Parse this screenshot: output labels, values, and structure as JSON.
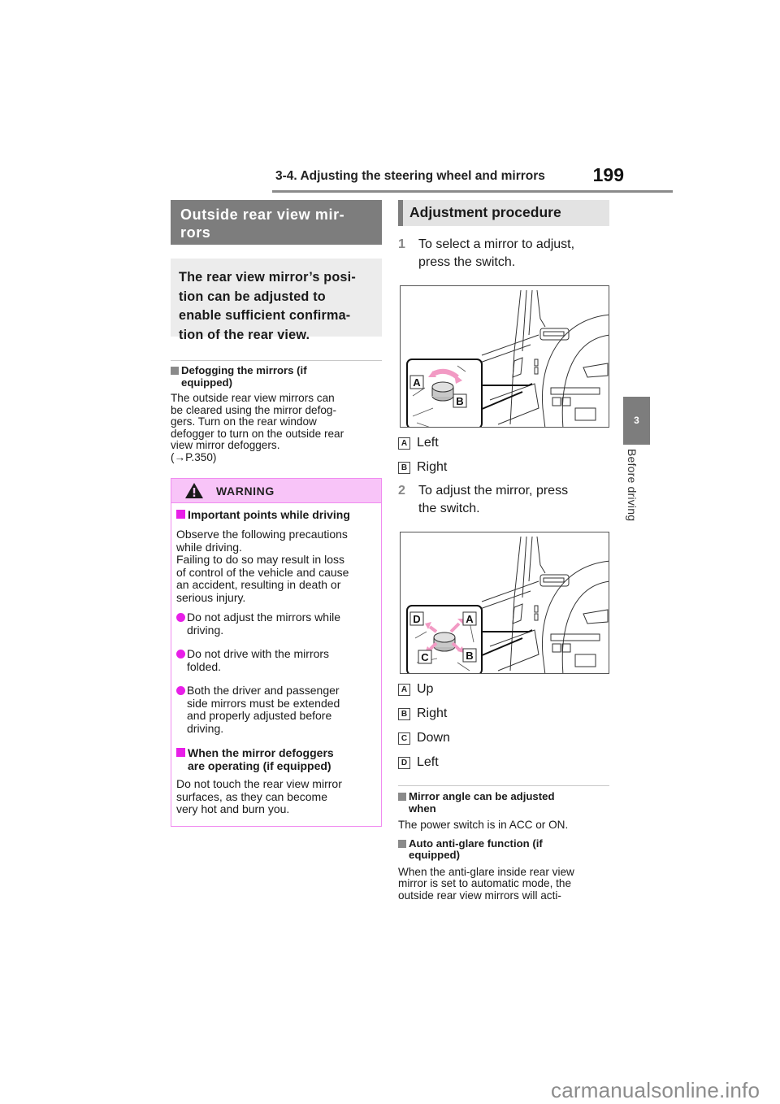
{
  "header": {
    "section_title": "3-4. Adjusting the steering wheel and mirrors",
    "page_number": "199"
  },
  "side_tab": {
    "chapter_number": "3",
    "chapter_label": "Before driving"
  },
  "left": {
    "section_title": "Outside rear view mir-\nrors",
    "intro": "The rear view mirror’s posi-\ntion can be adjusted to\nenable sufficient confirma-\ntion of the rear view.",
    "defog": {
      "heading": "Defogging the mirrors (if\nequipped)",
      "body": "The outside rear view mirrors can\nbe cleared using the mirror defog-\ngers. Turn on the rear window\ndefogger to turn on the outside rear\nview mirror defoggers.\n(→P.350)"
    },
    "warning": {
      "title": "WARNING",
      "icon": "warning-triangle-icon",
      "sub1_heading": "Important points while driving",
      "sub1_body": "Observe the following precautions\nwhile driving.\nFailing to do so may result in loss\nof control of the vehicle and cause\nan accident, resulting in death or\nserious injury.",
      "bullets": [
        "Do not adjust the mirrors while\ndriving.",
        "Do not drive with the mirrors\nfolded.",
        "Both the driver and passenger\nside mirrors must be extended\nand properly adjusted before\ndriving."
      ],
      "sub2_heading": "When the mirror defoggers\nare operating (if equipped)",
      "sub2_body": "Do not touch the rear view mirror\nsurfaces, as they can become\nvery hot and burn you."
    }
  },
  "right": {
    "section_title": "Adjustment procedure",
    "steps": [
      {
        "number": "1",
        "text": "To select a mirror to adjust,\npress the switch."
      },
      {
        "number": "2",
        "text": "To adjust the mirror, press\nthe switch."
      }
    ],
    "figure1": {
      "callouts": [
        "A",
        "B"
      ],
      "legend": [
        {
          "label": "A",
          "text": "Left"
        },
        {
          "label": "B",
          "text": "Right"
        }
      ]
    },
    "figure2": {
      "callouts": [
        "A",
        "B",
        "C",
        "D"
      ],
      "legend": [
        {
          "label": "A",
          "text": "Up"
        },
        {
          "label": "B",
          "text": "Right"
        },
        {
          "label": "C",
          "text": "Down"
        },
        {
          "label": "D",
          "text": "Left"
        }
      ]
    },
    "note1": {
      "heading": "Mirror angle can be adjusted\nwhen",
      "body": "The power switch is in ACC or ON."
    },
    "note2": {
      "heading": "Auto anti-glare function (if\nequipped)",
      "body": "When the anti-glare inside rear view\nmirror is set to automatic mode, the\noutside rear view mirrors will acti-"
    }
  },
  "colors": {
    "accent_magenta": "#e81ee8",
    "warning_header_bg": "#f8c4f8",
    "section_gray": "#7d7d7d",
    "arrow_pink": "#f29ac4"
  },
  "watermark": "carmanualsonline.info"
}
